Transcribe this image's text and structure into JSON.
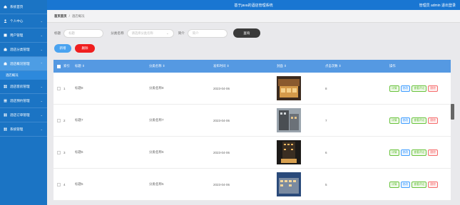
{
  "sidebar": {
    "items": [
      {
        "label": "系统首页",
        "icon": "home-icon",
        "chevron": false
      },
      {
        "label": "个人中心",
        "icon": "user-icon",
        "chevron": true
      },
      {
        "label": "用户管理",
        "icon": "list-icon",
        "chevron": true
      },
      {
        "label": "酒店分类管理",
        "icon": "hotel-icon",
        "chevron": true
      },
      {
        "label": "酒店概况管理",
        "icon": "hotel-icon",
        "chevron": true
      }
    ],
    "sub_item": "酒店概况",
    "items2": [
      {
        "label": "酒店客房管理",
        "icon": "grid-icon",
        "chevron": true
      },
      {
        "label": "酒店预约管理",
        "icon": "list-icon",
        "chevron": true
      },
      {
        "label": "酒店订单管理",
        "icon": "grid-icon",
        "chevron": true
      },
      {
        "label": "系统管理",
        "icon": "grid-icon",
        "chevron": true
      }
    ]
  },
  "topbar": {
    "title": "基于java的酒店管理系统",
    "user": "管理员 admin",
    "logout": "退出登录"
  },
  "breadcrumb": {
    "home": "首页首页",
    "sep": "/",
    "current": "酒店概况"
  },
  "search": {
    "title_label": "标题",
    "title_placeholder": "标题",
    "category_label": "分类名称",
    "category_placeholder": "请选择分类名称",
    "extra_label": "简介",
    "extra_placeholder": "简介",
    "query_button": "查询"
  },
  "actions": {
    "add": "新增",
    "delete": "删除"
  },
  "table": {
    "headers": [
      "索引",
      "标题 ⇕",
      "分类名称 ⇕",
      "发布时间 ⇕",
      "封面 ⇕",
      "点击次数 ⇕",
      "操作"
    ],
    "rows": [
      {
        "index": "1",
        "title": "标题8",
        "category": "分类名称8",
        "date": "2023-04-06",
        "clicks": "8"
      },
      {
        "index": "2",
        "title": "标题7",
        "category": "分类名称7",
        "date": "2023-04-06",
        "clicks": "7"
      },
      {
        "index": "3",
        "title": "标题6",
        "category": "分类名称6",
        "date": "2023-04-06",
        "clicks": "6"
      },
      {
        "index": "4",
        "title": "标题5",
        "category": "分类名称5",
        "date": "2023-04-06",
        "clicks": "5"
      }
    ],
    "ops": {
      "detail": "详情",
      "edit": "修改",
      "review": "查看评论",
      "remove": "删除"
    }
  },
  "colors": {
    "sidebar": "#1b74c4",
    "topbar": "#1976d2",
    "header": "#5599e2",
    "delete": "#f01e1e",
    "add": "#4aa3f0"
  }
}
